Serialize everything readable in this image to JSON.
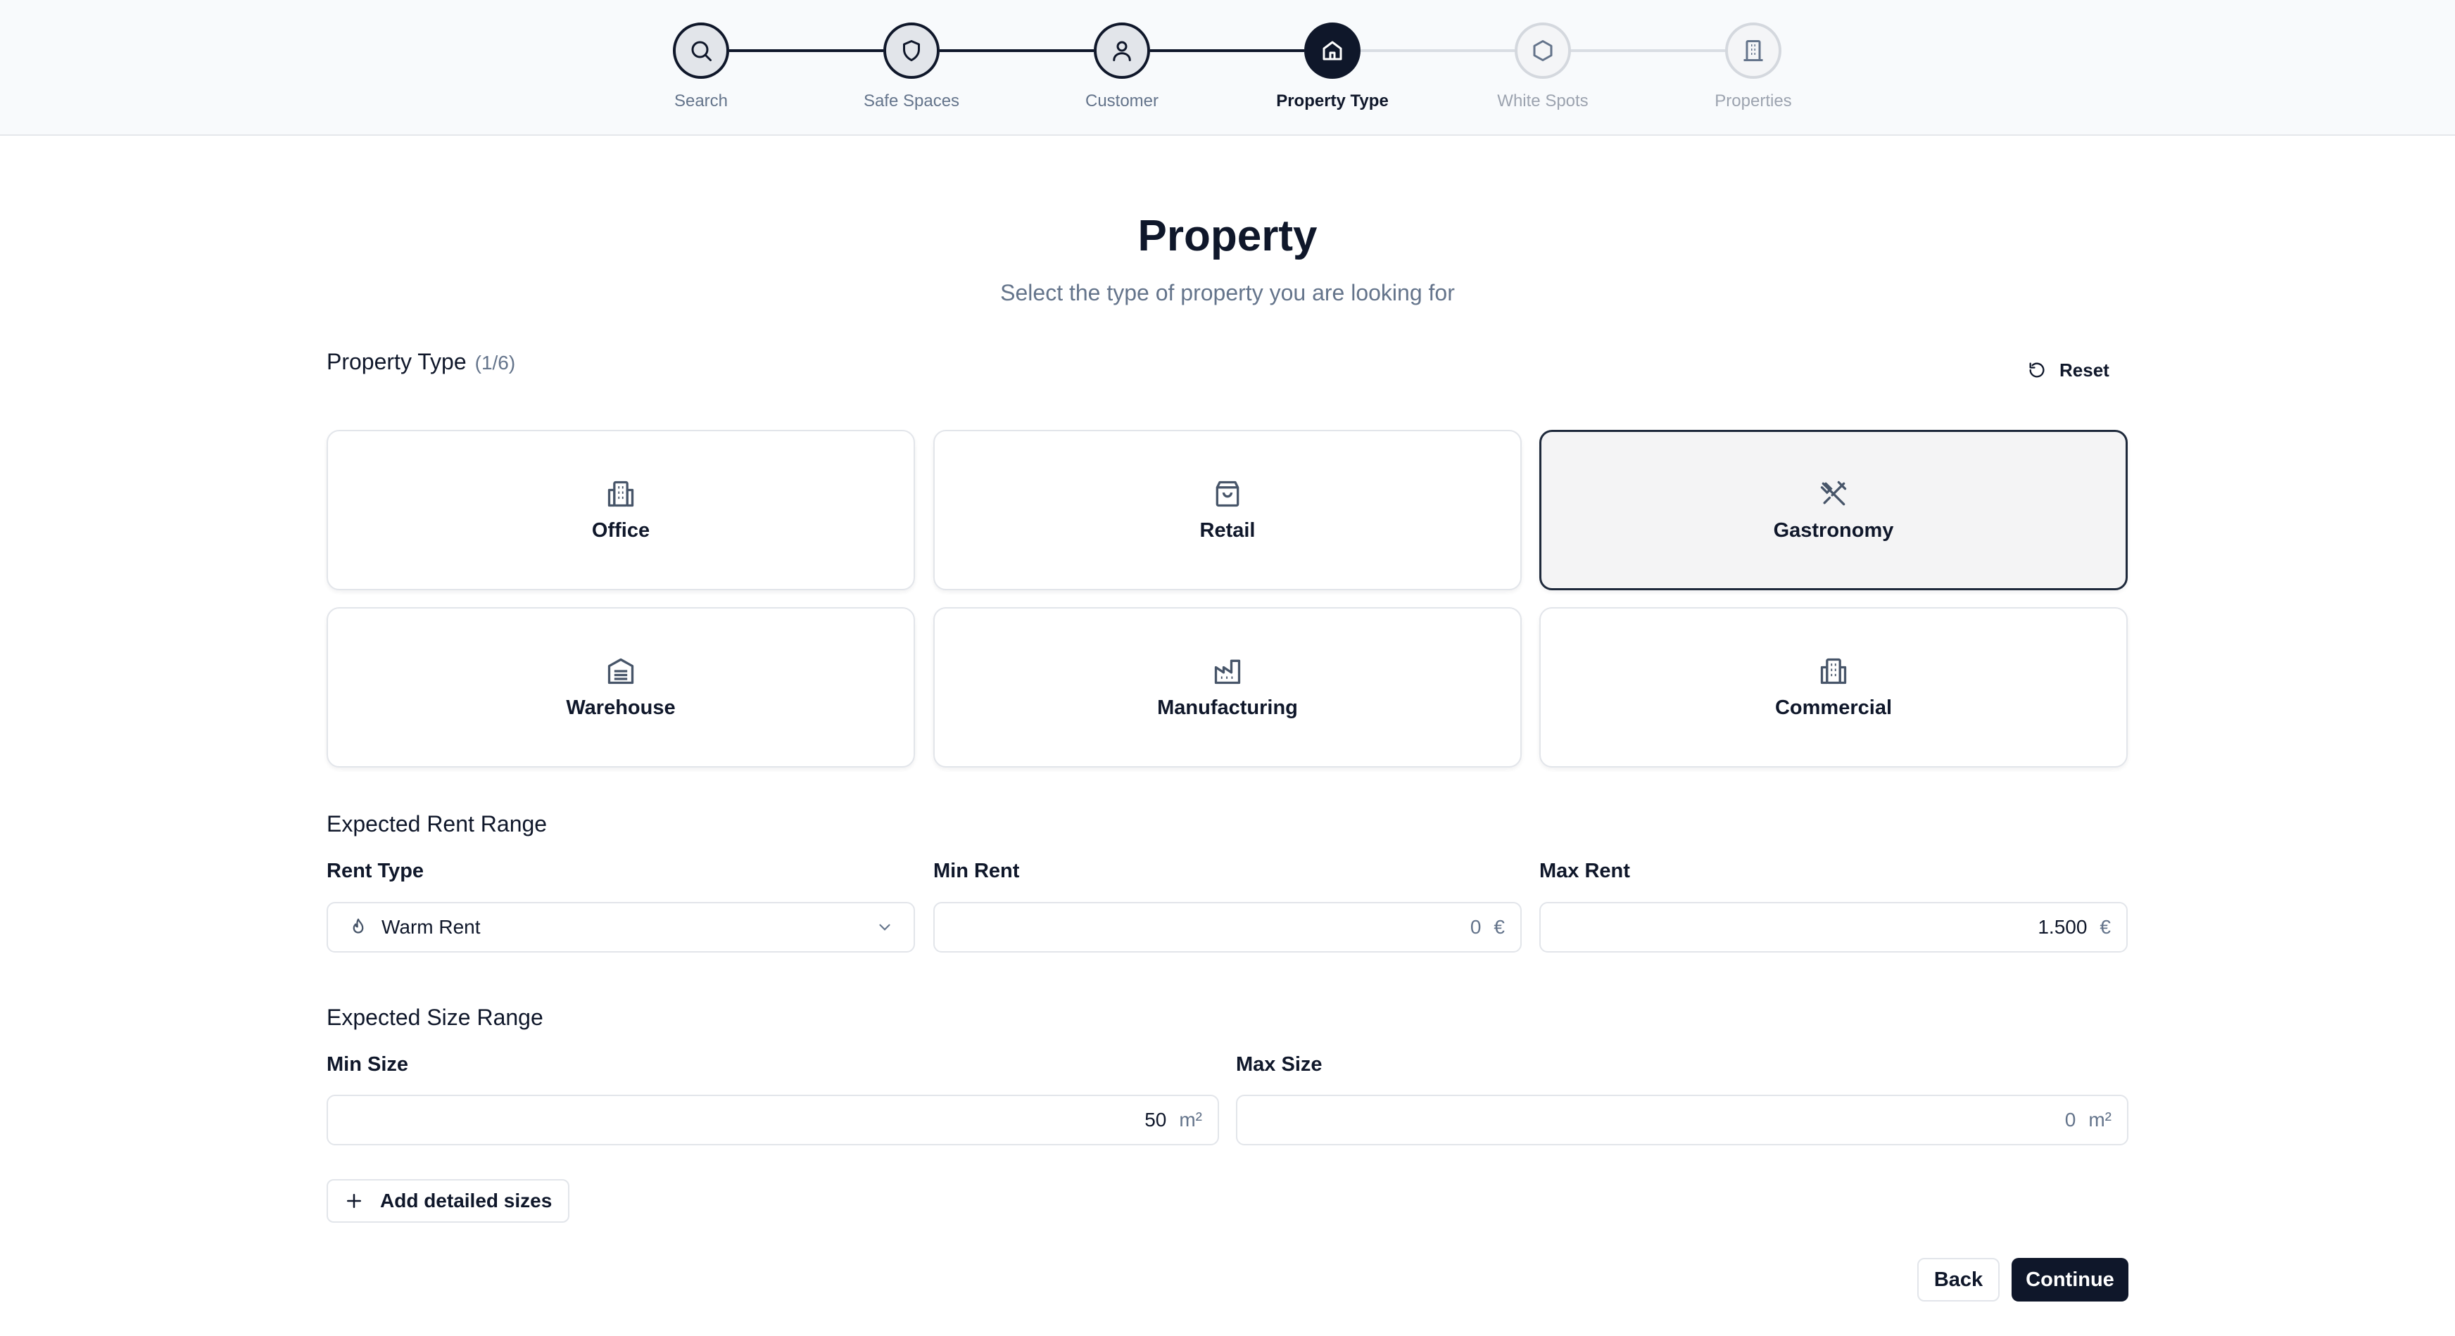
{
  "stepper": {
    "steps": [
      {
        "label": "Search",
        "icon": "search-icon",
        "state": "complete"
      },
      {
        "label": "Safe Spaces",
        "icon": "shield-icon",
        "state": "complete"
      },
      {
        "label": "Customer",
        "icon": "user-icon",
        "state": "complete"
      },
      {
        "label": "Property Type",
        "icon": "home-icon",
        "state": "active"
      },
      {
        "label": "White Spots",
        "icon": "hexagon-icon",
        "state": "upcoming"
      },
      {
        "label": "Properties",
        "icon": "building-icon",
        "state": "upcoming"
      }
    ]
  },
  "header": {
    "title": "Property",
    "subtitle": "Select the type of property you are looking for"
  },
  "property_type": {
    "label": "Property Type",
    "count": "(1/6)",
    "reset_label": "Reset",
    "options": [
      {
        "label": "Office",
        "icon": "office-building-icon",
        "selected": false
      },
      {
        "label": "Retail",
        "icon": "shopping-bag-icon",
        "selected": false
      },
      {
        "label": "Gastronomy",
        "icon": "utensils-crossed-icon",
        "selected": true
      },
      {
        "label": "Warehouse",
        "icon": "warehouse-icon",
        "selected": false
      },
      {
        "label": "Manufacturing",
        "icon": "factory-icon",
        "selected": false
      },
      {
        "label": "Commercial",
        "icon": "commercial-building-icon",
        "selected": false
      }
    ]
  },
  "rent": {
    "section_label": "Expected Rent Range",
    "rent_type_label": "Rent Type",
    "rent_type_value": "Warm Rent",
    "rent_type_icon": "flame-icon",
    "min_label": "Min Rent",
    "min_value": "0",
    "max_label": "Max Rent",
    "max_value": "1.500",
    "currency": "€"
  },
  "size": {
    "section_label": "Expected Size Range",
    "min_label": "Min Size",
    "min_value": "50",
    "max_label": "Max Size",
    "max_value": "0",
    "unit": "m²",
    "add_detailed_label": "Add detailed sizes"
  },
  "footer": {
    "back_label": "Back",
    "continue_label": "Continue"
  },
  "colors": {
    "primary": "#0f172a",
    "muted": "#64748b",
    "border": "#e2e5ea",
    "selected_bg": "#f4f4f5"
  }
}
